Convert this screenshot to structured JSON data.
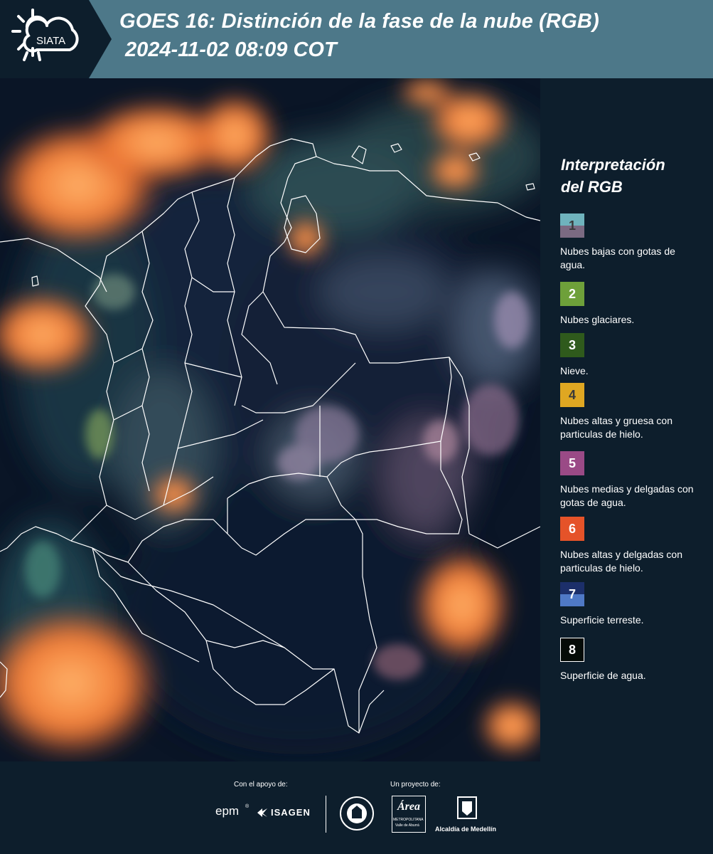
{
  "header": {
    "logo_text": "SIATA",
    "title_line1": "GOES 16: Distinción de la fase de la nube (RGB)",
    "title_line2": "2024-11-02 08:09 COT"
  },
  "legend": {
    "title_line1": "Interpretación",
    "title_line2": "del RGB",
    "items": [
      {
        "number": "1",
        "label": "Nubes bajas con gotas de agua.",
        "color_top": "#6fb3bd",
        "color_bottom": "#7b6a82",
        "text_color": "#3a3a3a"
      },
      {
        "number": "2",
        "label": "Nubes glaciares.",
        "color_top": "#6ea03a",
        "color_bottom": "#6ea03a",
        "text_color": "#ffffff"
      },
      {
        "number": "3",
        "label": "Nieve.",
        "color_top": "#2f5a1c",
        "color_bottom": "#2f5a1c",
        "text_color": "#ffffff"
      },
      {
        "number": "4",
        "label": "Nubes altas y gruesa con particulas de hielo.",
        "color_top": "#dfa722",
        "color_bottom": "#dfa722",
        "text_color": "#3a3a3a"
      },
      {
        "number": "5",
        "label": "Nubes medias y delgadas con gotas de agua.",
        "color_top": "#9a4a86",
        "color_bottom": "#9a4a86",
        "text_color": "#ffffff"
      },
      {
        "number": "6",
        "label": "Nubes altas y delgadas con particulas de hielo.",
        "color_top": "#e55329",
        "color_bottom": "#e55329",
        "text_color": "#ffffff"
      },
      {
        "number": "7",
        "label": "Superficie terreste.",
        "color_top": "#1c2f6a",
        "color_bottom": "#4f79c6",
        "text_color": "#ffffff"
      },
      {
        "number": "8",
        "label": "Superficie de agua.",
        "color_top": "#050b07",
        "color_bottom": "#050b07",
        "text_color": "#ffffff"
      }
    ]
  },
  "footer": {
    "support_caption": "Con el apoyo de:",
    "project_caption": "Un proyecto de:",
    "epm_logo": "epm",
    "isagen_logo": "ISAGEN",
    "area_logo": "Área",
    "area_subtitle": "METROPOLITANA",
    "area_subtitle2": "Valle de Aburrá",
    "alcaldia_label": "Alcaldía de Medellín"
  },
  "colors": {
    "header_bg": "#4d7889",
    "panel_bg": "#0d1e2c",
    "map_bg": "#0a1526",
    "cloud_orange": "#f07a35",
    "border_white": "#ffffff"
  }
}
